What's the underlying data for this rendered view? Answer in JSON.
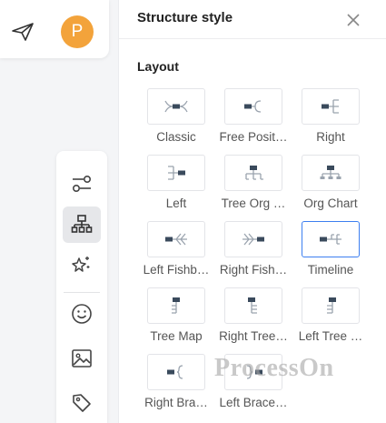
{
  "top_icons": {
    "send": "send-icon",
    "avatar_letter": "P"
  },
  "toolbar": {
    "items": [
      {
        "name": "connector-icon",
        "active": false
      },
      {
        "name": "structure-icon",
        "active": true
      },
      {
        "name": "magic-sparkle-icon",
        "active": false
      },
      {
        "name": "emoji-icon",
        "active": false
      },
      {
        "name": "image-icon",
        "active": false
      },
      {
        "name": "tag-icon",
        "active": false
      }
    ]
  },
  "panel": {
    "title": "Structure style",
    "section_label": "Layout",
    "options": [
      {
        "label": "Classic",
        "icon": "classic-layout-icon"
      },
      {
        "label": "Free Posit…",
        "icon": "free-position-layout-icon"
      },
      {
        "label": "Right",
        "icon": "right-layout-icon"
      },
      {
        "label": "Left",
        "icon": "left-layout-icon"
      },
      {
        "label": "Tree Org …",
        "icon": "tree-org-layout-icon"
      },
      {
        "label": "Org Chart",
        "icon": "org-chart-layout-icon"
      },
      {
        "label": "Left Fishb…",
        "icon": "left-fishbone-layout-icon"
      },
      {
        "label": "Right Fish…",
        "icon": "right-fishbone-layout-icon"
      },
      {
        "label": "Timeline",
        "icon": "timeline-layout-icon",
        "selected": true
      },
      {
        "label": "Tree Map",
        "icon": "tree-map-layout-icon"
      },
      {
        "label": "Right Tree…",
        "icon": "right-tree-layout-icon"
      },
      {
        "label": "Left Tree …",
        "icon": "left-tree-layout-icon"
      },
      {
        "label": "Right Bra…",
        "icon": "right-brace-layout-icon"
      },
      {
        "label": "Left Brace…",
        "icon": "left-brace-layout-icon"
      }
    ]
  },
  "colors": {
    "accent": "#3d7ff0",
    "avatar": "#f3a33b",
    "icon_dark": "#3a4a5c",
    "icon_muted": "#9aa3ae"
  },
  "watermark": "ProcessOn"
}
